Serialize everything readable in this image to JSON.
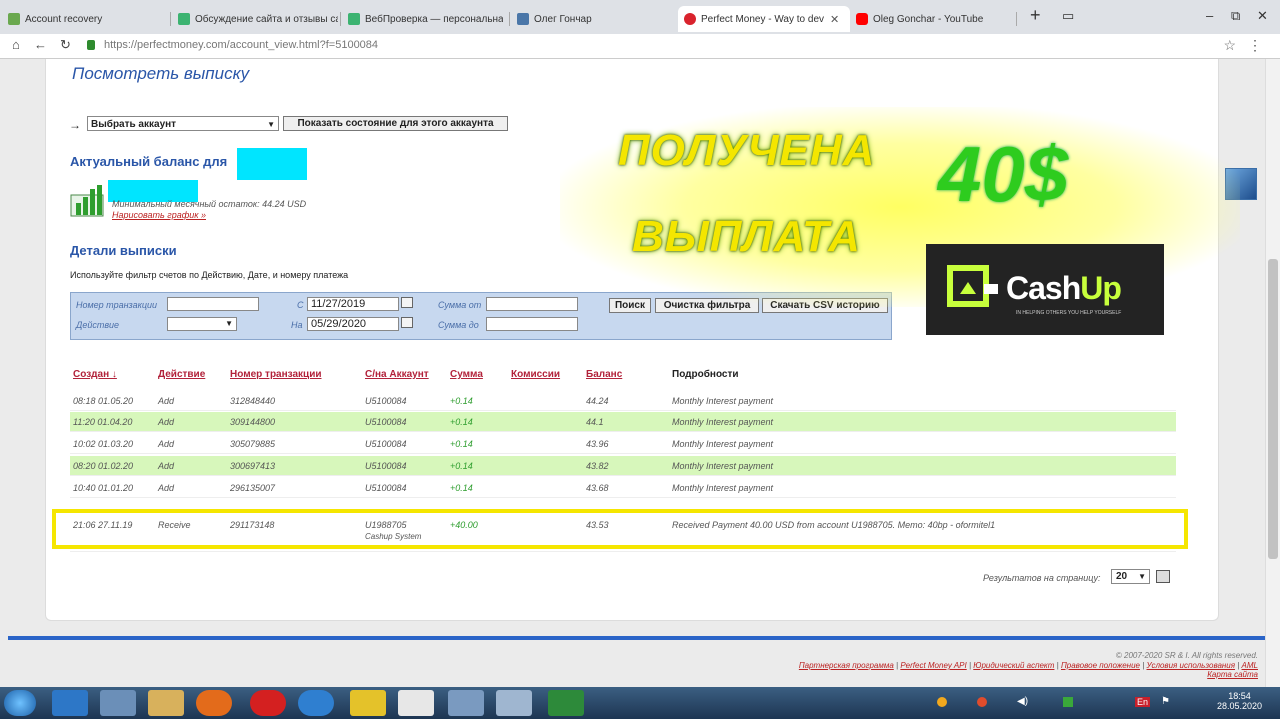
{
  "browser": {
    "tabs": [
      {
        "title": "Account recovery",
        "color": "#6aa84f"
      },
      {
        "title": "Обсуждение сайта и отзывы са",
        "color": "#3cb371"
      },
      {
        "title": "ВебПроверка — персональная",
        "color": "#3cb371"
      },
      {
        "title": "Олег Гончар",
        "color": "#4a76a8"
      },
      {
        "title": "Perfect Money - Way to dev",
        "color": "#d9232d"
      },
      {
        "title": "Oleg Gonchar - YouTube",
        "color": "#ff0000"
      }
    ],
    "url": "https://perfectmoney.com/account_view.html?f=5100084"
  },
  "page": {
    "title": "Посмотреть выписку",
    "select_account": "Выбрать аккаунт",
    "show_state_btn": "Показать состояние для этого аккаунта",
    "balance_heading": "Актуальный баланс для",
    "avg_balance": "Минимальный месячный остаток: 44.24 USD",
    "draw_chart": "Нарисовать график",
    "details_heading": "Детали выписки",
    "filter_hint": "Используйте фильтр счетов по Действию, Дате, и номеру платежа"
  },
  "filter": {
    "txn_label": "Номер транзакции",
    "action_label": "Действие",
    "from_label": "С",
    "to_label": "На",
    "from_date": "11/27/2019",
    "to_date": "05/29/2020",
    "sum_from_label": "Сумма от",
    "sum_to_label": "Сумма до",
    "search_btn": "Поиск",
    "clear_btn": "Очистка фильтра",
    "csv_btn": "Скачать CSV историю"
  },
  "table": {
    "headers": [
      "Создан ↓",
      "Действие",
      "Номер транзакции",
      "С/на Аккаунт",
      "Сумма",
      "Комиссии",
      "Баланс",
      "Подробности"
    ],
    "rows": [
      {
        "created": "08:18 01.05.20",
        "action": "Add",
        "txn": "312848440",
        "account": "U5100084",
        "amount": "+0.14",
        "balance": "44.24",
        "details": "Monthly Interest payment"
      },
      {
        "created": "11:20 01.04.20",
        "action": "Add",
        "txn": "309144800",
        "account": "U5100084",
        "amount": "+0.14",
        "balance": "44.1",
        "details": "Monthly Interest payment"
      },
      {
        "created": "10:02 01.03.20",
        "action": "Add",
        "txn": "305079885",
        "account": "U5100084",
        "amount": "+0.14",
        "balance": "43.96",
        "details": "Monthly Interest payment"
      },
      {
        "created": "08:20 01.02.20",
        "action": "Add",
        "txn": "300697413",
        "account": "U5100084",
        "amount": "+0.14",
        "balance": "43.82",
        "details": "Monthly Interest payment"
      },
      {
        "created": "10:40 01.01.20",
        "action": "Add",
        "txn": "296135007",
        "account": "U5100084",
        "amount": "+0.14",
        "balance": "43.68",
        "details": "Monthly Interest payment"
      }
    ],
    "receive_row": {
      "created": "21:06 27.11.19",
      "action": "Receive",
      "txn": "291173148",
      "account": "U1988705",
      "account_sub": "Cashup System",
      "amount": "+40.00",
      "balance": "43.53",
      "details": "Received Payment 40.00 USD from account U1988705. Memo: 40bp - oformitel1"
    },
    "per_page_label": "Результатов на страницу:",
    "per_page_value": "20"
  },
  "footer": {
    "copyright": "© 2007-2020 SR & I. All rights reserved.",
    "links": [
      "Партнерская программа",
      "Perfect Money API",
      "Юридический аспект",
      "Правовое положение",
      "Условия использования",
      "AML"
    ],
    "sitemap": "Карта сайта"
  },
  "overlay": {
    "line1": "ПОЛУЧЕНА",
    "line2": "ВЫПЛАТА",
    "amount": "40$",
    "logo_text_a": "Cash",
    "logo_text_b": "Up",
    "logo_tagline": "IN HELPING OTHERS YOU HELP YOURSELF"
  },
  "taskbar": {
    "time": "18:54",
    "date": "28.05.2020",
    "lang": "En"
  }
}
